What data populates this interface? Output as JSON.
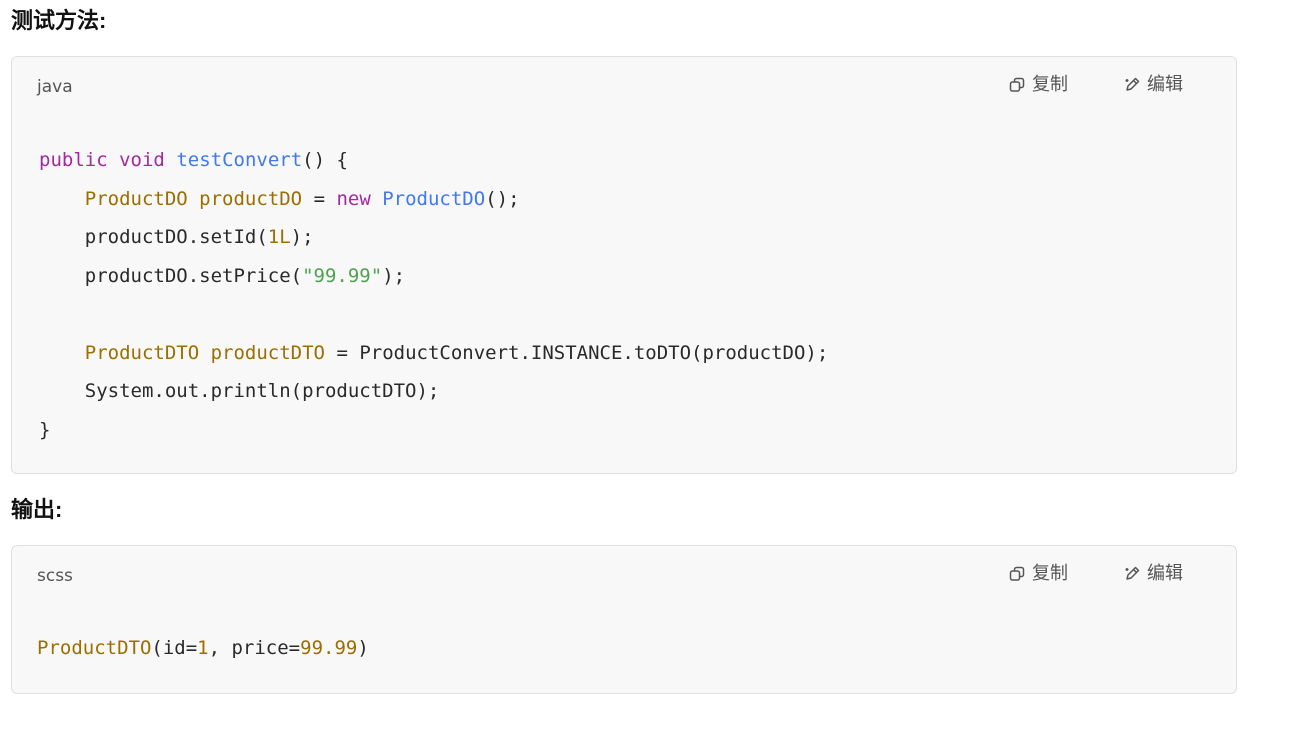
{
  "sections": [
    {
      "heading": "测试方法:",
      "language": "java",
      "copy_label": "复制",
      "edit_label": "编辑",
      "lines": [
        [
          {
            "t": "public",
            "c": "kw"
          },
          {
            "t": " ",
            "c": "plain"
          },
          {
            "t": "void",
            "c": "kw"
          },
          {
            "t": " ",
            "c": "plain"
          },
          {
            "t": "testConvert",
            "c": "fn"
          },
          {
            "t": "() {",
            "c": "plain"
          }
        ],
        [
          {
            "t": "    ",
            "c": "plain"
          },
          {
            "t": "ProductDO",
            "c": "type"
          },
          {
            "t": " ",
            "c": "plain"
          },
          {
            "t": "productDO",
            "c": "type"
          },
          {
            "t": " = ",
            "c": "plain"
          },
          {
            "t": "new",
            "c": "kw"
          },
          {
            "t": " ",
            "c": "plain"
          },
          {
            "t": "ProductDO",
            "c": "fn"
          },
          {
            "t": "();",
            "c": "plain"
          }
        ],
        [
          {
            "t": "    productDO.setId(",
            "c": "plain"
          },
          {
            "t": "1L",
            "c": "num"
          },
          {
            "t": ");",
            "c": "plain"
          }
        ],
        [
          {
            "t": "    productDO.setPrice(",
            "c": "plain"
          },
          {
            "t": "\"99.99\"",
            "c": "str"
          },
          {
            "t": ");",
            "c": "plain"
          }
        ],
        [
          {
            "t": "",
            "c": "plain"
          }
        ],
        [
          {
            "t": "    ",
            "c": "plain"
          },
          {
            "t": "ProductDTO",
            "c": "type"
          },
          {
            "t": " ",
            "c": "plain"
          },
          {
            "t": "productDTO",
            "c": "type"
          },
          {
            "t": " = ProductConvert.INSTANCE.toDTO(productDO);",
            "c": "plain"
          }
        ],
        [
          {
            "t": "    System.out.println(productDTO);",
            "c": "plain"
          }
        ],
        [
          {
            "t": "}",
            "c": "plain"
          }
        ]
      ]
    },
    {
      "heading": "输出:",
      "language": "scss",
      "copy_label": "复制",
      "edit_label": "编辑",
      "lines": [
        [
          {
            "t": "ProductDTO",
            "c": "type"
          },
          {
            "t": "(id=",
            "c": "plain"
          },
          {
            "t": "1",
            "c": "num"
          },
          {
            "t": ", price=",
            "c": "plain"
          },
          {
            "t": "99.99",
            "c": "num"
          },
          {
            "t": ")",
            "c": "plain"
          }
        ]
      ]
    }
  ],
  "icons": {
    "copy": "copy-icon",
    "edit": "edit-pencil-icon"
  },
  "colors": {
    "keyword": "#a626a4",
    "function": "#4078f2",
    "type": "#9c6e00",
    "number": "#9c6e00",
    "string": "#50a14f",
    "code_background": "#f8f8f8"
  }
}
